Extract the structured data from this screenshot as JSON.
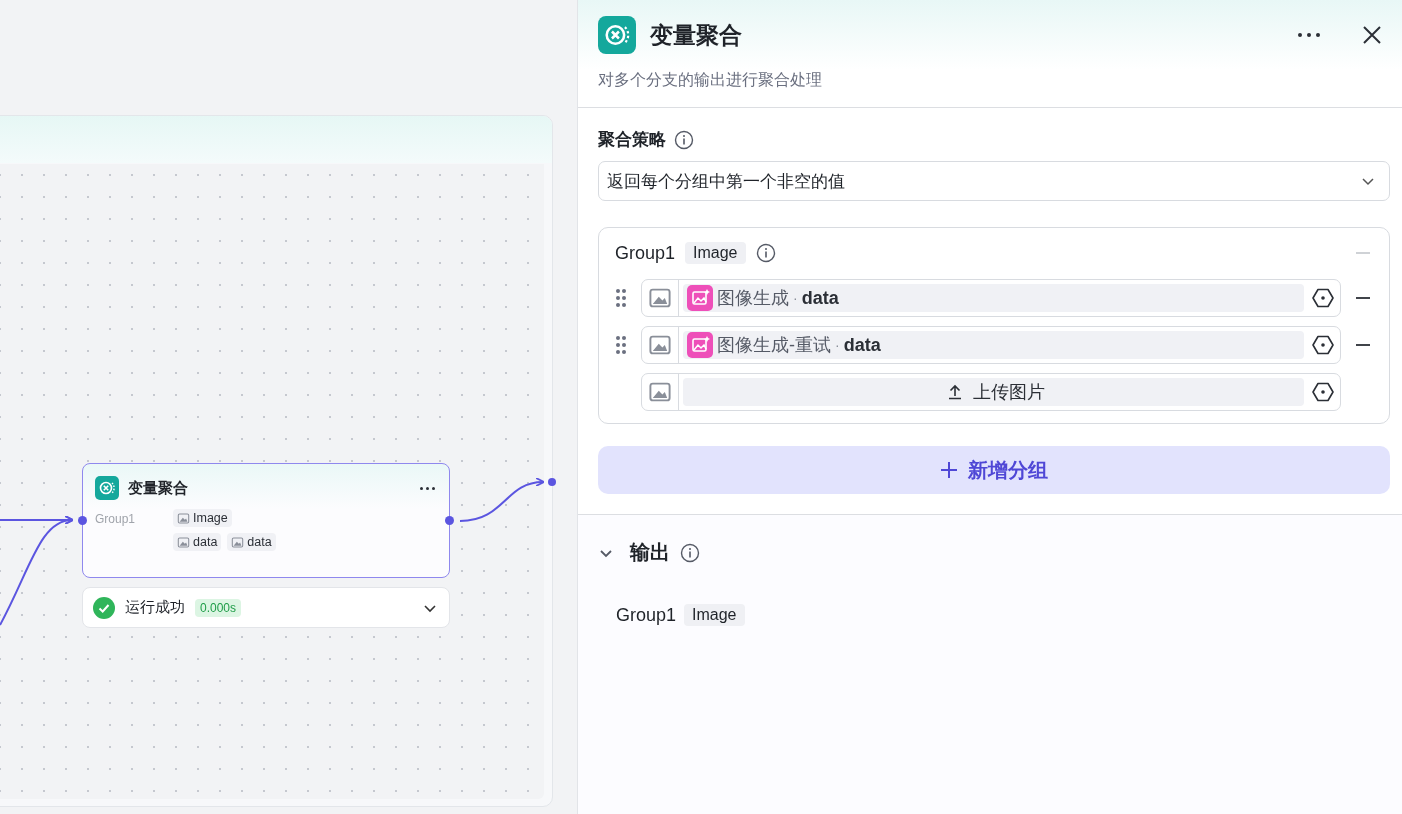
{
  "canvas": {
    "node": {
      "title": "变量聚合",
      "groups": [
        {
          "name": "Group1",
          "type": "Image",
          "vars": [
            "data",
            "data"
          ]
        }
      ]
    },
    "run_status": {
      "label": "运行成功",
      "time": "0.000s",
      "success": true
    }
  },
  "panel": {
    "title": "变量聚合",
    "description": "对多个分支的输出进行聚合处理",
    "strategy": {
      "label": "聚合策略",
      "value": "返回每个分组中第一个非空的值"
    },
    "groups": [
      {
        "name": "Group1",
        "type": "Image",
        "items": [
          {
            "kind": "variable",
            "source": "图像生成",
            "separator": "·",
            "var": "data"
          },
          {
            "kind": "variable",
            "source": "图像生成-重试",
            "separator": "·",
            "var": "data"
          },
          {
            "kind": "upload",
            "label": "上传图片"
          }
        ]
      }
    ],
    "add_group_button": "新增分组",
    "output": {
      "label": "输出",
      "expanded": true,
      "items": [
        {
          "name": "Group1",
          "type": "Image"
        }
      ]
    }
  }
}
